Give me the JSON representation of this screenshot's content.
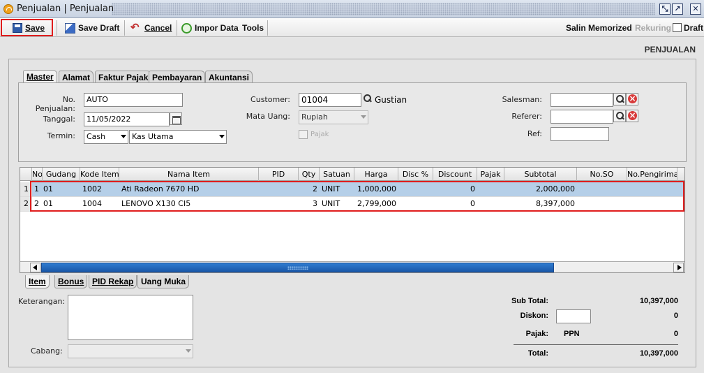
{
  "window": {
    "title": "Penjualan | Penjualan"
  },
  "toolbar": {
    "save": "Save",
    "save_draft": "Save Draft",
    "cancel": "Cancel",
    "impor_data": "Impor Data",
    "tools": "Tools",
    "salin_memorized": "Salin Memorized",
    "rekuring": "Rekuring",
    "draft": "Draft"
  },
  "page_header": "PENJUALAN",
  "top_tabs": [
    "Master",
    "Alamat",
    "Faktur Pajak",
    "Pembayaran",
    "Akuntansi"
  ],
  "master": {
    "no_penjualan_label": "No. Penjualan:",
    "no_penjualan": "AUTO",
    "tanggal_label": "Tanggal:",
    "tanggal": "11/05/2022",
    "termin_label": "Termin:",
    "termin": "Cash",
    "kas": "Kas Utama",
    "customer_label": "Customer:",
    "customer_code": "01004",
    "customer_name": "Gustian",
    "mata_uang_label": "Mata Uang:",
    "mata_uang": "Rupiah",
    "pajak_label": "Pajak",
    "salesman_label": "Salesman:",
    "salesman": "",
    "referer_label": "Referer:",
    "referer": "",
    "ref_label": "Ref:",
    "ref": ""
  },
  "grid": {
    "columns": [
      "No",
      "Gudang",
      "Kode Item",
      "Nama Item",
      "PID",
      "Qty",
      "Satuan",
      "Harga",
      "Disc %",
      "Discount",
      "Pajak",
      "Subtotal",
      "No.SO",
      "No.Pengiriman"
    ],
    "rows": [
      {
        "idx": "1",
        "no": "1",
        "gudang": "01",
        "kode": "1002",
        "nama": "Ati Radeon 7670 HD",
        "pid": "",
        "qty": "2",
        "satuan": "UNIT",
        "harga": "1,000,000",
        "disc": "",
        "discount": "0",
        "pajak": "",
        "subtotal": "2,000,000",
        "so": "",
        "pengiriman": ""
      },
      {
        "idx": "2",
        "no": "2",
        "gudang": "01",
        "kode": "1004",
        "nama": "LENOVO X130 CI5",
        "pid": "",
        "qty": "3",
        "satuan": "UNIT",
        "harga": "2,799,000",
        "disc": "",
        "discount": "0",
        "pajak": "",
        "subtotal": "8,397,000",
        "so": "",
        "pengiriman": ""
      }
    ]
  },
  "bottom_tabs": [
    "Item",
    "Bonus",
    "PID Rekap",
    "Uang Muka"
  ],
  "footer": {
    "keterangan_label": "Keterangan:",
    "cabang_label": "Cabang:",
    "sub_total_label": "Sub Total:",
    "sub_total": "10,397,000",
    "diskon_label": "Diskon:",
    "diskon": "0",
    "pajak_label": "Pajak:",
    "pajak_type": "PPN",
    "pajak": "0",
    "total_label": "Total:",
    "total": "10,397,000"
  },
  "colors": {
    "highlight_red": "#e01d1d",
    "row_selected": "#b5cfe8",
    "scroll_thumb": "#2f7bd0"
  }
}
